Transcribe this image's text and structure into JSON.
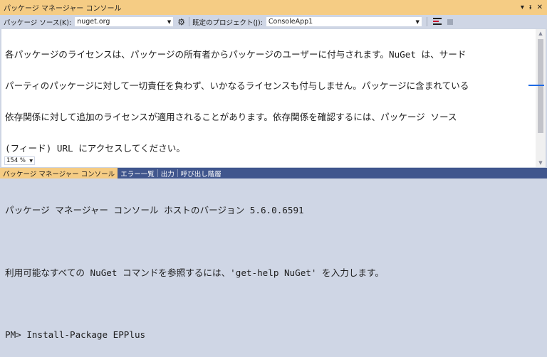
{
  "window": {
    "title": "パッケージ マネージャー コンソール",
    "pin_glyph": "▾",
    "autohide_glyph": "ᵻ",
    "close_glyph": "✕"
  },
  "toolbar": {
    "source_label": "パッケージ ソース(K):",
    "source_value": "nuget.org",
    "project_label": "既定のプロジェクト(J):",
    "project_value": "ConsoleApp1"
  },
  "console": {
    "lines": [
      "各パッケージのライセンスは、パッケージの所有者からパッケージのユーザーに付与されます。NuGet は、サード",
      "パーティのパッケージに対して一切責任を負わず、いかなるライセンスも付与しません。パッケージに含まれている",
      "依存関係に対して追加のライセンスが適用されることがあります。依存関係を確認するには、パッケージ ソース",
      "(フィード) URL にアクセスしてください。",
      "",
      "パッケージ マネージャー コンソール ホストのバージョン 5.6.0.6591",
      "",
      "利用可能なすべての NuGet コマンドを参照するには、'get-help NuGet' を入力します。",
      "",
      "PM> Install-Package EPPlus"
    ]
  },
  "zoom": {
    "value": "154 %"
  },
  "tabs": [
    {
      "label": "パッケージ マネージャー コンソール",
      "active": true
    },
    {
      "label": "エラー一覧",
      "active": false
    },
    {
      "label": "出力",
      "active": false
    },
    {
      "label": "呼び出し階層",
      "active": false
    }
  ],
  "colors": {
    "accent_active": "#f5cc84",
    "tab_strip": "#40568d",
    "toolbar_bg": "#cfd6e5",
    "scroll_marker": "#1d6ae5"
  }
}
